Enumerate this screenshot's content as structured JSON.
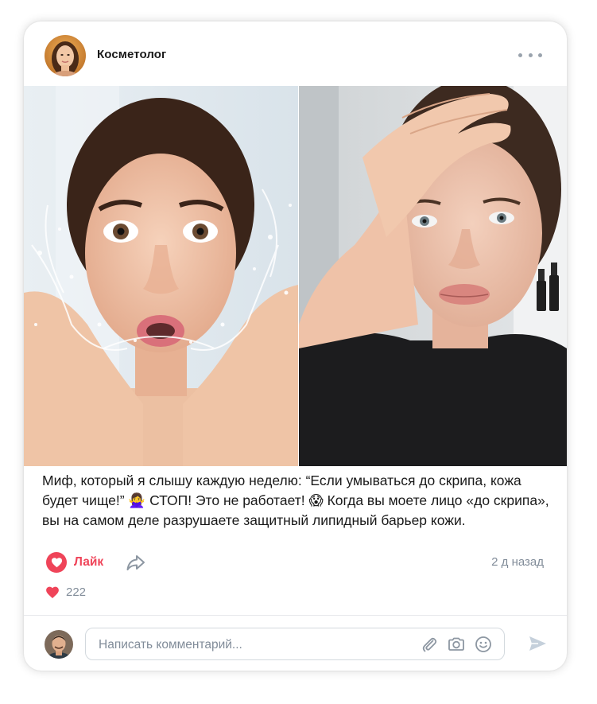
{
  "post": {
    "author_name": "Косметолог",
    "text": "Миф, который я слышу каждую неделю: “Если умываться до скрипа, кожа будет чище!” 🙅‍♀️ СТОП! Это не работает! 😱 Когда вы моете лицо «до скрипа», вы на самом деле разрушаете защитный липидный барьер кожи.",
    "timestamp": "2 д назад",
    "likes_count": "222"
  },
  "actions": {
    "like_label": "Лайк"
  },
  "comment": {
    "placeholder": "Написать комментарий..."
  },
  "icons": {
    "more": "more-dots-icon",
    "like": "heart-icon",
    "share": "share-arrow-icon",
    "attach": "paperclip-icon",
    "camera": "camera-icon",
    "emoji": "smiley-icon",
    "send": "send-icon"
  },
  "colors": {
    "accent_red": "#ef4459",
    "muted_text": "#818c99",
    "icon_gray": "#9aa3ad",
    "send_gray": "#c5d0db"
  }
}
